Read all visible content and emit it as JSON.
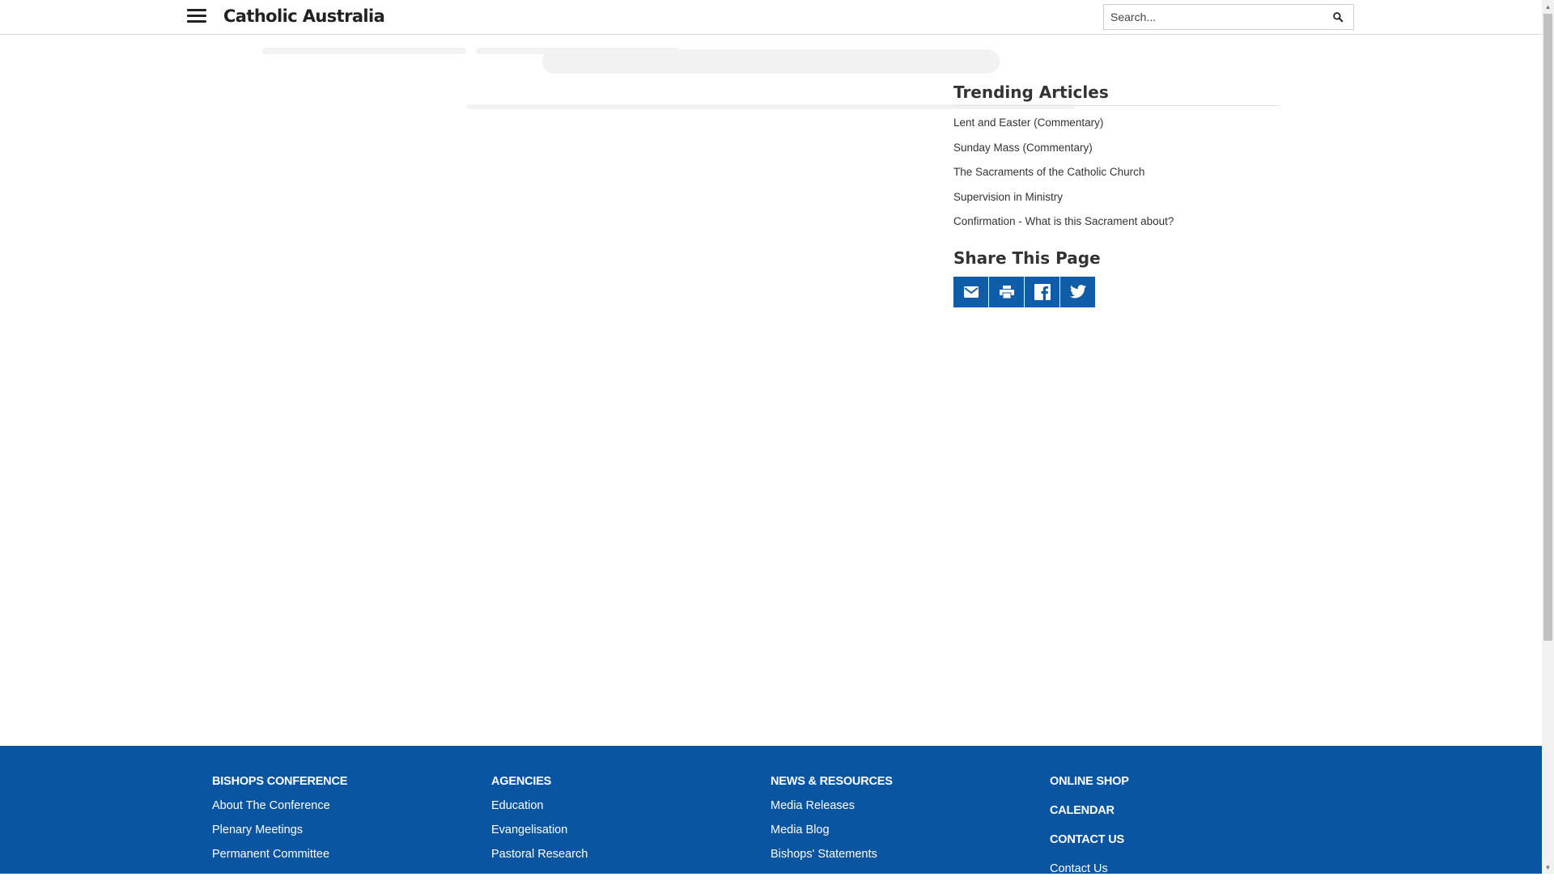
{
  "header": {
    "site_title": "Catholic Australia",
    "search_placeholder": "Search..."
  },
  "sidebar": {
    "trending_heading": "Trending Articles",
    "trending_articles": [
      "Lent and Easter (Commentary)",
      "Sunday Mass (Commentary)",
      "The Sacraments of the Catholic Church",
      "Supervision in Ministry",
      "Confirmation - What is this Sacrament about?"
    ],
    "share_heading": "Share This Page",
    "share_buttons": [
      "email-icon",
      "print-icon",
      "facebook-icon",
      "twitter-icon"
    ]
  },
  "footer": {
    "background_color": "#0a55a2",
    "columns": [
      {
        "heading": "BISHOPS CONFERENCE",
        "links": [
          "About The Conference",
          "Plenary Meetings",
          "Permanent Committee"
        ]
      },
      {
        "heading": "AGENCIES",
        "links": [
          "Education",
          "Evangelisation",
          "Pastoral Research"
        ]
      },
      {
        "heading": "NEWS & RESOURCES",
        "links": [
          "Media Releases",
          "Media Blog",
          "Bishops' Statements"
        ]
      },
      {
        "headings": [
          "ONLINE SHOP",
          "CALENDAR",
          "CONTACT US"
        ],
        "links": [
          "Contact Us"
        ]
      }
    ]
  },
  "colors": {
    "share_button": "#0f5da8",
    "footer": "#0a55a2"
  }
}
